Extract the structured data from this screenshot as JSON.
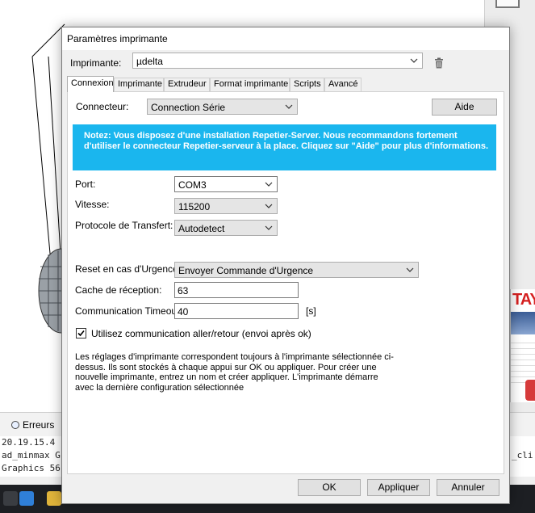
{
  "background": {
    "errors_tab_label": "Erreurs",
    "console_lines": [
      "20.19.15.4",
      "ad_minmax G",
      "Graphics 56"
    ],
    "console_right_fragment": "_cli",
    "side_banner_text": "TAY"
  },
  "dialog": {
    "title": "Paramètres imprimante",
    "printer_label": "Imprimante:",
    "printer_value": "µdelta",
    "tabs": [
      {
        "label": "Connexion"
      },
      {
        "label": "Imprimante"
      },
      {
        "label": "Extrudeur"
      },
      {
        "label": "Format imprimante"
      },
      {
        "label": "Scripts"
      },
      {
        "label": "Avancé"
      }
    ],
    "connexion": {
      "connector_label": "Connecteur:",
      "connector_value": "Connection Série",
      "help_button": "Aide",
      "notice": "Notez: Vous disposez d'une installation Repetier-Server. Nous recommandons fortement d'utiliser le connecteur Repetier-serveur à la place. Cliquez sur \"Aide\" pour plus d'informations.",
      "port_label": "Port:",
      "port_value": "COM3",
      "speed_label": "Vitesse:",
      "speed_value": "115200",
      "protocol_label": "Protocole de Transfert:",
      "protocol_value": "Autodetect",
      "emergency_label": "Reset en cas d'Urgence",
      "emergency_value": "Envoyer Commande d'Urgence",
      "cache_label": "Cache de réception:",
      "cache_value": "63",
      "timeout_label": "Communication Timeout:",
      "timeout_value": "40",
      "timeout_unit": "[s]",
      "pingpong_label": "Utilisez communication aller/retour (envoi après ok)",
      "pingpong_checked": true,
      "info_text": "Les réglages d'imprimante correspondent toujours à l'imprimante sélectionnée ci-dessus. Ils sont stockés à chaque appui sur OK ou appliquer. Pour créer une nouvelle imprimante, entrez un nom et créer appliquer. L'imprimante démarre avec la dernière configuration sélectionnée"
    },
    "buttons": {
      "ok": "OK",
      "apply": "Appliquer",
      "cancel": "Annuler"
    },
    "colors": {
      "notice_bg": "#1ab6ee",
      "notice_text": "#ffffff",
      "dialog_bg": "#f0f0f0"
    }
  }
}
